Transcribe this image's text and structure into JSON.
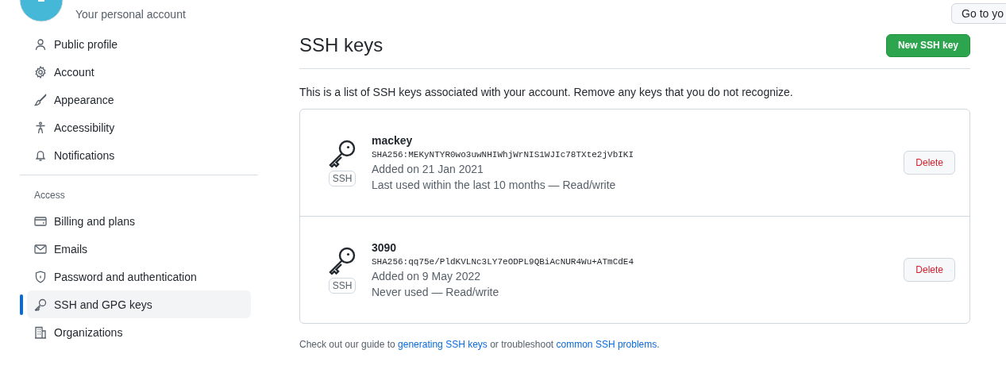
{
  "account": {
    "subtitle": "Your personal account",
    "goto_button": "Go to yo"
  },
  "sidebar": {
    "groups": [
      {
        "items": [
          {
            "label": "Public profile",
            "selected": false
          },
          {
            "label": "Account",
            "selected": false
          },
          {
            "label": "Appearance",
            "selected": false
          },
          {
            "label": "Accessibility",
            "selected": false
          },
          {
            "label": "Notifications",
            "selected": false
          }
        ]
      },
      {
        "heading": "Access",
        "items": [
          {
            "label": "Billing and plans",
            "selected": false
          },
          {
            "label": "Emails",
            "selected": false
          },
          {
            "label": "Password and authentication",
            "selected": false
          },
          {
            "label": "SSH and GPG keys",
            "selected": true
          },
          {
            "label": "Organizations",
            "selected": false
          }
        ]
      }
    ]
  },
  "main": {
    "title": "SSH keys",
    "new_button": "New SSH key",
    "description": "This is a list of SSH keys associated with your account. Remove any keys that you do not recognize.",
    "keys": [
      {
        "name": "mackey",
        "badge": "SSH",
        "fingerprint": "SHA256:MEKyNTYR0wo3uwNHIWhjWrNIS1WJIc78TXte2jVbIKI",
        "added": "Added on 21 Jan 2021",
        "usage": "Last used within the last 10 months — Read/write",
        "delete": "Delete"
      },
      {
        "name": "3090",
        "badge": "SSH",
        "fingerprint": "SHA256:qq75e/PldKVLNc3LY7eODPL9QBiAcNUR4Wu+ATmCdE4",
        "added": "Added on 9 May 2022",
        "usage": "Never used — Read/write",
        "delete": "Delete"
      }
    ],
    "footer": [
      {
        "kind": "text",
        "text": "Check out our guide to "
      },
      {
        "kind": "link",
        "text": "generating SSH keys"
      },
      {
        "kind": "text",
        "text": " or troubleshoot "
      },
      {
        "kind": "link",
        "text": "common SSH problems"
      },
      {
        "kind": "text",
        "text": "."
      }
    ]
  }
}
